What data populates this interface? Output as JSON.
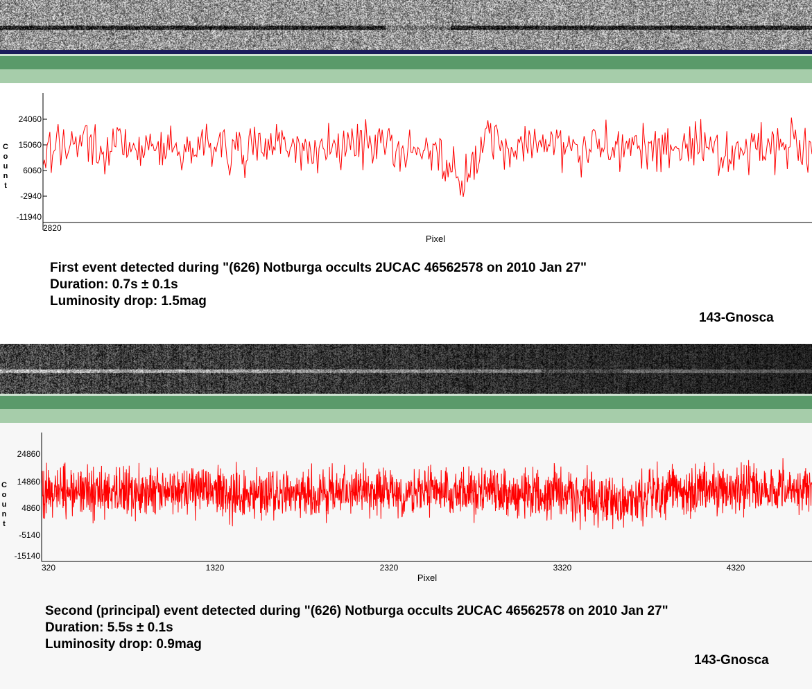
{
  "panels": [
    {
      "caption": {
        "title": "First event detected during \"(626) Notburga occults 2UCAC 46562578 on 2010 Jan 27\"",
        "duration": "Duration: 0.7s ± 0.1s",
        "drop": "Luminosity drop: 1.5mag"
      },
      "observer": "143-Gnosca",
      "strip_tone": "light",
      "colors": {
        "band_dark": "#5a9a6a",
        "band_light": "#a6cdaa",
        "line": "#ff0000",
        "background": "#ffffff",
        "navy_bar": "#1c1c5c"
      }
    },
    {
      "caption": {
        "title": "Second (principal) event detected during \"(626) Notburga occults 2UCAC 46562578 on 2010 Jan 27\"",
        "duration": "Duration: 5.5s ± 0.1s",
        "drop": "Luminosity drop: 0.9mag"
      },
      "observer": "143-Gnosca",
      "strip_tone": "dark",
      "colors": {
        "band_dark": "#5a9a6a",
        "band_light": "#a6cdaa",
        "line": "#ff0000",
        "background": "#f7f7f7"
      }
    }
  ],
  "chart_data": [
    {
      "type": "line",
      "title": "",
      "xlabel": "Pixel",
      "ylabel": "Count",
      "y_ticks": [
        24060,
        15060,
        6060,
        -2940,
        -11940
      ],
      "ylim": [
        -11940,
        33060
      ],
      "x_ticks": [
        2820
      ],
      "xlim": [
        2820,
        3800
      ],
      "grid": false,
      "series": [
        {
          "x": [
            2820,
            2870,
            2920,
            2970,
            3020,
            3070,
            3120,
            3170,
            3220,
            3270,
            3320,
            3330,
            3340,
            3350,
            3360,
            3370,
            3380,
            3420,
            3470,
            3520,
            3570,
            3620,
            3670,
            3720,
            3770,
            3800
          ],
          "values": [
            11500,
            13500,
            14000,
            13000,
            14500,
            13000,
            13500,
            12500,
            13000,
            14000,
            13000,
            9000,
            4500,
            1500,
            4000,
            9000,
            14500,
            14000,
            13000,
            12500,
            13500,
            13000,
            12500,
            13000,
            13500,
            13000
          ],
          "noise_amplitude": 5500
        }
      ]
    },
    {
      "type": "line",
      "title": "",
      "xlabel": "Pixel",
      "ylabel": "Count",
      "y_ticks": [
        24860,
        14860,
        4860,
        -5140,
        -15140
      ],
      "ylim": [
        -15140,
        29860
      ],
      "x_ticks": [
        320,
        1320,
        2320,
        3320,
        4320
      ],
      "xlim": [
        320,
        4740
      ],
      "grid": false,
      "series": [
        {
          "x": [
            320,
            600,
            900,
            1320,
            1700,
            2000,
            2320,
            2700,
            3000,
            3320,
            3400,
            3500,
            3600,
            3700,
            3800,
            3900,
            4100,
            4320,
            4500,
            4740
          ],
          "values": [
            10500,
            10000,
            10500,
            10000,
            9500,
            10000,
            10000,
            10000,
            9500,
            9500,
            8000,
            6500,
            6000,
            6500,
            9000,
            10000,
            10500,
            10000,
            10500,
            10500
          ],
          "noise_amplitude": 6000
        }
      ]
    }
  ]
}
